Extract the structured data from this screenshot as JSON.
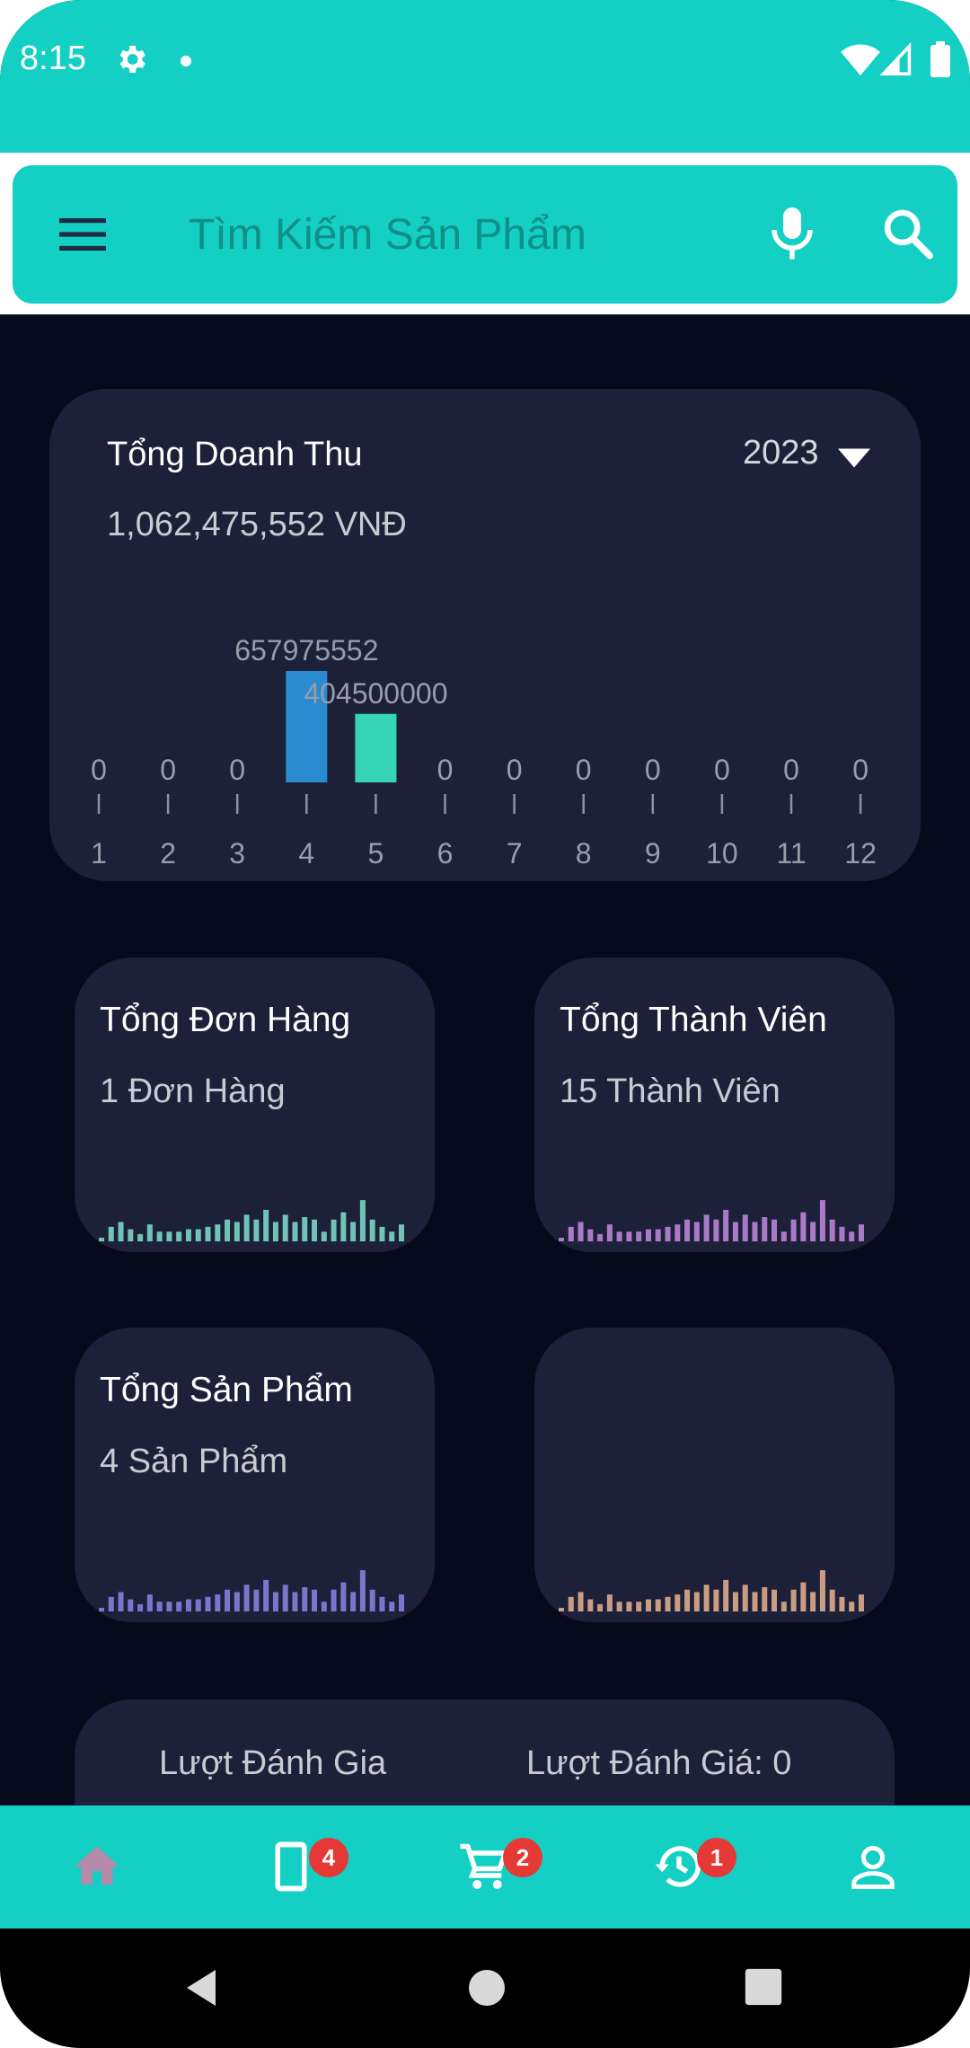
{
  "status_bar": {
    "time": "8:15"
  },
  "search": {
    "placeholder": "Tìm Kiếm Sản Phẩm"
  },
  "revenue": {
    "title": "Tổng Doanh Thu",
    "year": "2023",
    "total": "1,062,475,552 VNĐ"
  },
  "chart_data": {
    "type": "bar",
    "title": "Tổng Doanh Thu",
    "categories": [
      "1",
      "2",
      "3",
      "4",
      "5",
      "6",
      "7",
      "8",
      "9",
      "10",
      "11",
      "12"
    ],
    "values": [
      0,
      0,
      0,
      657975552,
      404500000,
      0,
      0,
      0,
      0,
      0,
      0,
      0
    ],
    "value_labels": [
      "0",
      "0",
      "0",
      "657975552",
      "404500000",
      "0",
      "0",
      "0",
      "0",
      "0",
      "0",
      "0"
    ],
    "colors": [
      "#2a8bd1",
      "#2a8bd1",
      "#2a8bd1",
      "#2a8bd1",
      "#36d5b6",
      "#2a8bd1",
      "#2a8bd1",
      "#2a8bd1",
      "#2a8bd1",
      "#2a8bd1",
      "#2a8bd1",
      "#2a8bd1"
    ],
    "ylim": [
      0,
      657975552
    ],
    "grid": false
  },
  "stats": {
    "orders": {
      "title": "Tổng Đơn Hàng",
      "value": "1 Đơn Hàng",
      "color": "#7fe0cc"
    },
    "members": {
      "title": "Tổng Thành Viên",
      "value": "15 Thành Viên",
      "color": "#c48be0"
    },
    "products": {
      "title": "Tổng Sản Phẩm",
      "value": "4 Sản Phẩm",
      "color": "#8c86e6"
    },
    "empty": {
      "color": "#e9b48f"
    }
  },
  "reviews": {
    "left": "Lượt Đánh Gia",
    "right": "Lượt Đánh Giá: 0"
  },
  "bottom_nav": {
    "items": [
      {
        "icon": "home-icon",
        "badge": ""
      },
      {
        "icon": "phone-icon",
        "badge": "4"
      },
      {
        "icon": "cart-icon",
        "badge": "2"
      },
      {
        "icon": "history-icon",
        "badge": "1"
      },
      {
        "icon": "profile-icon",
        "badge": ""
      }
    ],
    "active_color": "#b58aa8"
  }
}
